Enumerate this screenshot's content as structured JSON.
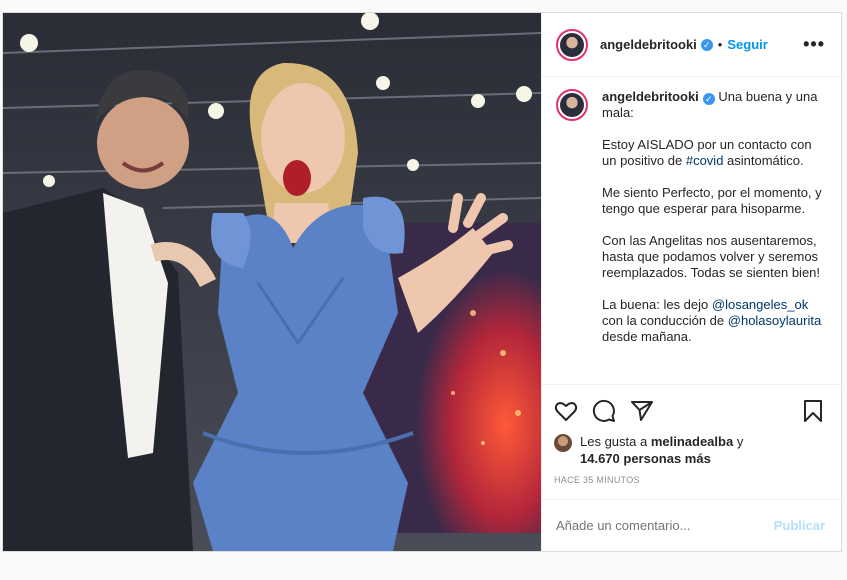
{
  "post": {
    "username": "angeldebritooki",
    "separator": "•",
    "follow_label": "Seguir",
    "more_label": "•••",
    "verified_glyph": "✓",
    "caption": {
      "username": "angeldebritooki",
      "line1": " Una buena y una mala:\n\nEstoy AISLADO por un contacto con un positivo de ",
      "hashtag": "#covid",
      "line2": " asintomático.\n\nMe siento Perfecto, por el momento, y tengo que esperar para hisoparme.\n\nCon las Angelitas nos ausentaremos, hasta que podamos volver y seremos reemplazados. Todas se sienten bien!\n\nLa buena: les dejo ",
      "mention1": "@losangeles_ok",
      "line3": " con la conducción de ",
      "mention2": "@holasoylaurita",
      "line4": " desde mañana."
    },
    "likes": {
      "prefix": "Les gusta a ",
      "user": "melinadealba",
      "middle": " y",
      "count": "14.670 personas más"
    },
    "time": "HACE 35 MINUTOS",
    "comment_placeholder": "Añade un comentario...",
    "publish_label": "Publicar"
  },
  "icons": [
    "heart-icon",
    "comment-icon",
    "share-icon",
    "bookmark-icon",
    "more-icon"
  ],
  "colors": {
    "accent": "#0095f6",
    "verified": "#3897f0",
    "publish_disabled": "#b2dffc",
    "dress": "#5b82c6"
  }
}
